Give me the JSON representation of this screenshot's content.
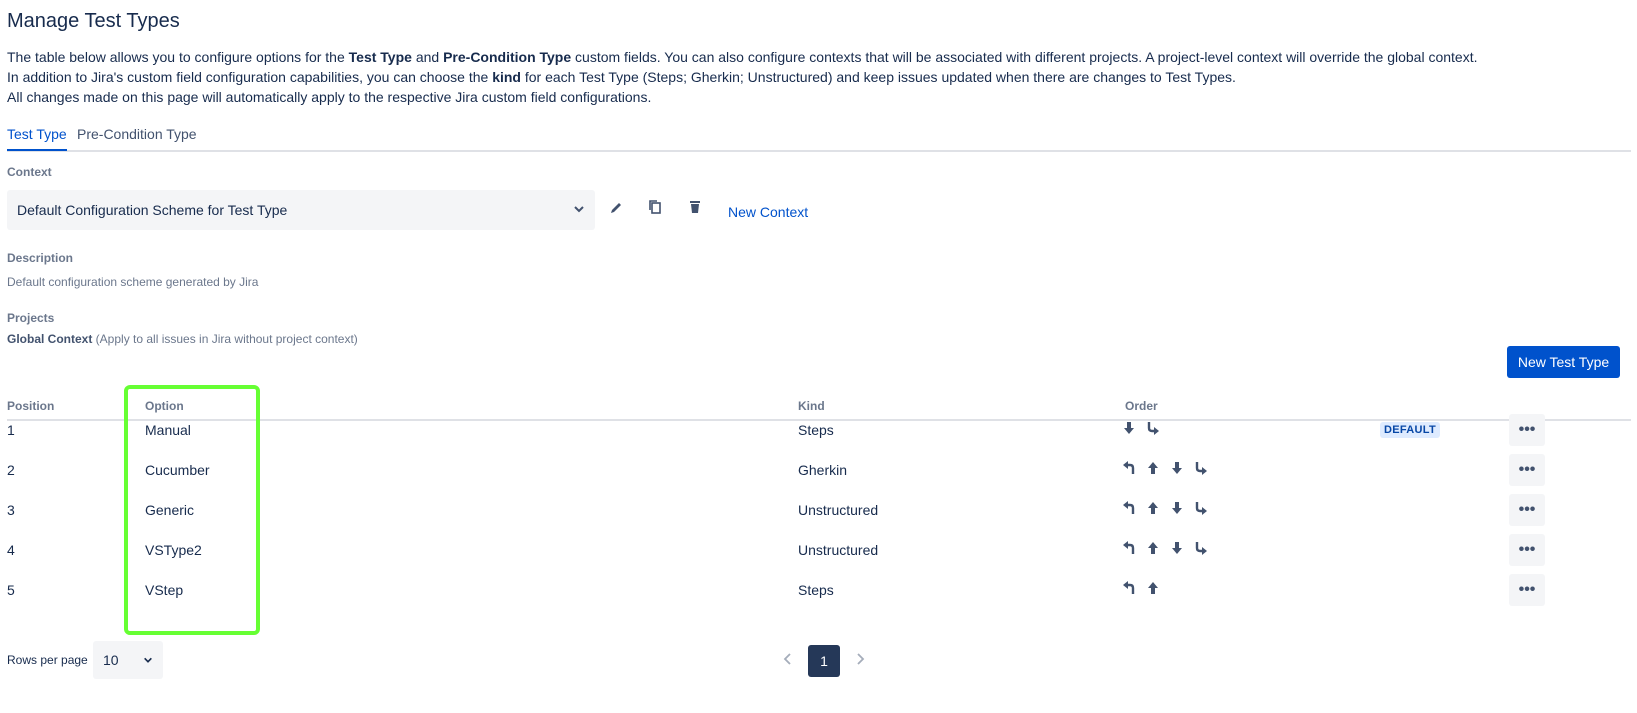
{
  "page": {
    "title": "Manage Test Types",
    "intro": {
      "line1_a": "The table below allows you to configure options for the ",
      "line1_b": "Test Type",
      "line1_c": " and ",
      "line1_d": "Pre-Condition Type",
      "line1_e": " custom fields. You can also configure contexts that will be associated with different projects. A project-level context will override the global context.",
      "line2_a": "In addition to Jira's custom field configuration capabilities, you can choose the ",
      "line2_b": "kind",
      "line2_c": " for each Test Type (Steps; Gherkin; Unstructured) and keep issues updated when there are changes to Test Types.",
      "line3": "All changes made on this page will automatically apply to the respective Jira custom field configurations."
    }
  },
  "tabs": [
    {
      "label": "Test Type",
      "active": true
    },
    {
      "label": "Pre-Condition Type",
      "active": false
    }
  ],
  "context": {
    "label": "Context",
    "selected": "Default Configuration Scheme for Test Type",
    "new_context": "New Context"
  },
  "description": {
    "label": "Description",
    "text": "Default configuration scheme generated by Jira"
  },
  "projects": {
    "label": "Projects",
    "bold": "Global Context",
    "rest": " (Apply to all issues in Jira without project context)"
  },
  "new_test_type_button": "New Test Type",
  "table": {
    "headers": {
      "position": "Position",
      "option": "Option",
      "kind": "Kind",
      "order": "Order"
    },
    "rows": [
      {
        "position": "1",
        "option": "Manual",
        "kind": "Steps",
        "order": [
          "move-down",
          "move-bottom"
        ],
        "badge": "DEFAULT"
      },
      {
        "position": "2",
        "option": "Cucumber",
        "kind": "Gherkin",
        "order": [
          "move-top",
          "move-up",
          "move-down",
          "move-bottom"
        ],
        "badge": ""
      },
      {
        "position": "3",
        "option": "Generic",
        "kind": "Unstructured",
        "order": [
          "move-top",
          "move-up",
          "move-down",
          "move-bottom"
        ],
        "badge": ""
      },
      {
        "position": "4",
        "option": "VSType2",
        "kind": "Unstructured",
        "order": [
          "move-top",
          "move-up",
          "move-down",
          "move-bottom"
        ],
        "badge": ""
      },
      {
        "position": "5",
        "option": "VStep",
        "kind": "Steps",
        "order": [
          "move-top",
          "move-up"
        ],
        "badge": ""
      }
    ],
    "more_label": "•••"
  },
  "pagination": {
    "rows_per_page_label": "Rows per page",
    "rows_per_page_value": "10",
    "current_page": "1"
  },
  "colors": {
    "accent": "#0052cc",
    "highlight": "#66ff33"
  }
}
